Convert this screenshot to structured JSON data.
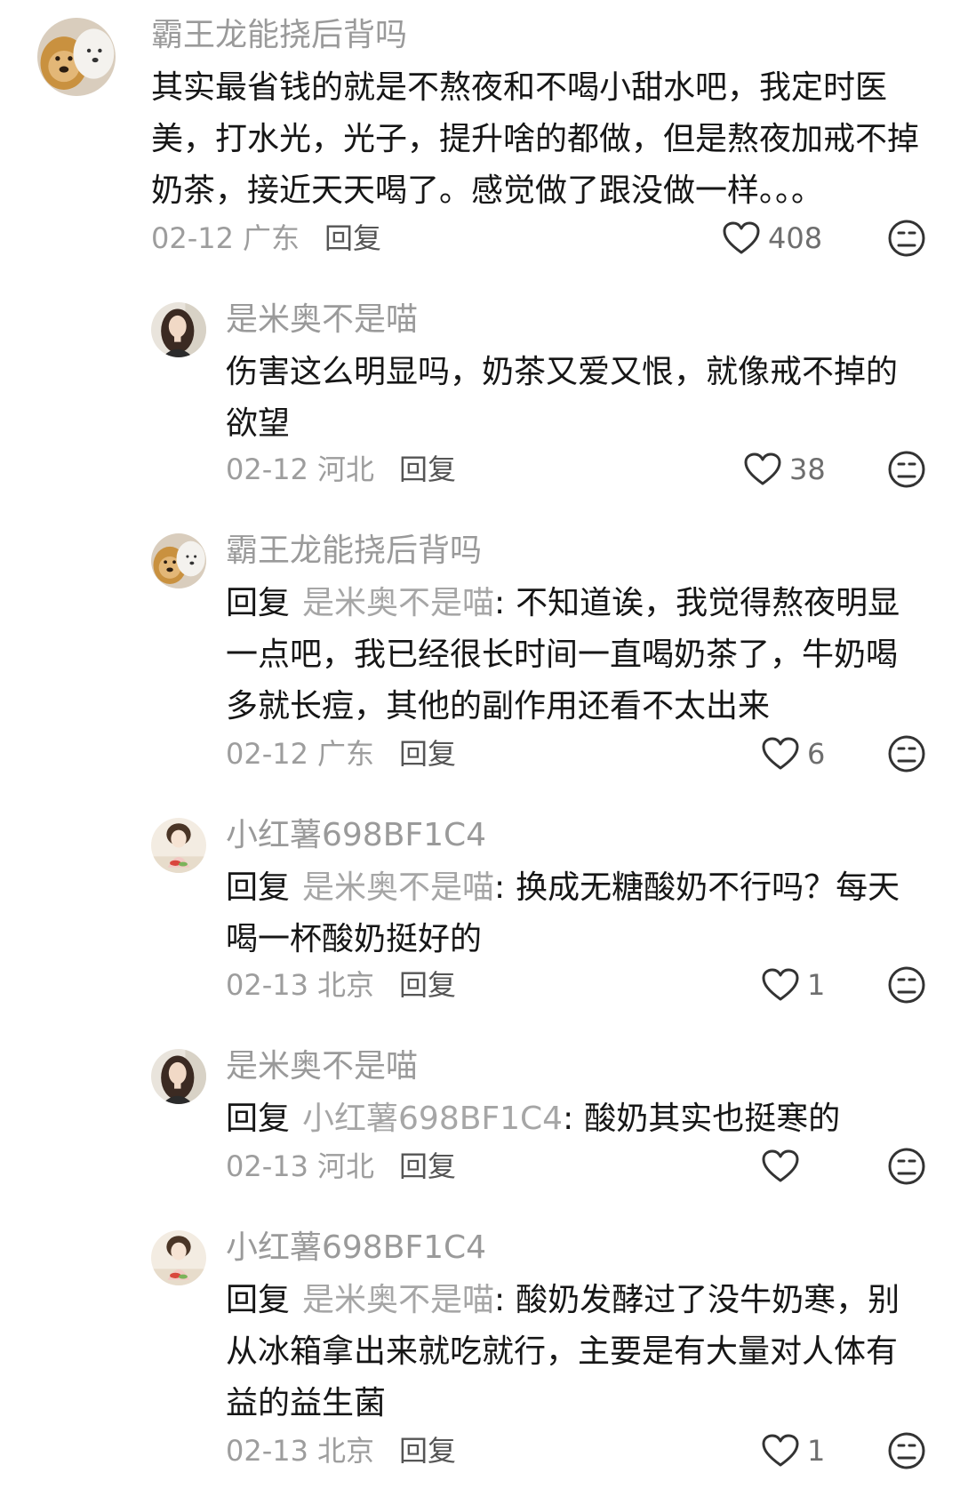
{
  "comments": [
    {
      "author": "霸王龙能挠后背吗",
      "avatar": "dog-avatar",
      "reply_label": "",
      "reply_to": "",
      "sep": "",
      "text": "其实最省钱的就是不熬夜和不喝小甜水吧，我定时医美，打水光，光子，提升啥的都做，但是熬夜加戒不掉奶茶，接近天天喝了。感觉做了跟没做一样。。。",
      "date": "02-12",
      "location": "广东",
      "reply_button": "回复",
      "likes": "408"
    },
    {
      "author": "是米奥不是喵",
      "avatar": "woman-avatar",
      "reply_label": "",
      "reply_to": "",
      "sep": "",
      "text": "伤害这么明显吗，奶茶又爱又恨，就像戒不掉的欲望",
      "date": "02-12",
      "location": "河北",
      "reply_button": "回复",
      "likes": "38"
    },
    {
      "author": "霸王龙能挠后背吗",
      "avatar": "dog-avatar",
      "reply_label": "回复",
      "reply_to": "是米奥不是喵",
      "sep": ":",
      "text": "不知道诶，我觉得熬夜明显一点吧，我已经很长时间一直喝奶茶了，牛奶喝多就长痘，其他的副作用还看不太出来",
      "date": "02-12",
      "location": "广东",
      "reply_button": "回复",
      "likes": "6"
    },
    {
      "author": "小红薯698BF1C4",
      "avatar": "cartoon-girl-avatar",
      "reply_label": "回复",
      "reply_to": "是米奥不是喵",
      "sep": ":",
      "text": "换成无糖酸奶不行吗？每天喝一杯酸奶挺好的",
      "date": "02-13",
      "location": "北京",
      "reply_button": "回复",
      "likes": "1"
    },
    {
      "author": "是米奥不是喵",
      "avatar": "woman-avatar",
      "reply_label": "回复",
      "reply_to": "小红薯698BF1C4",
      "sep": ":",
      "text": "酸奶其实也挺寒的",
      "date": "02-13",
      "location": "河北",
      "reply_button": "回复",
      "likes": ""
    },
    {
      "author": "小红薯698BF1C4",
      "avatar": "cartoon-girl-avatar",
      "reply_label": "回复",
      "reply_to": "是米奥不是喵",
      "sep": ":",
      "text": "酸奶发酵过了没牛奶寒，别从冰箱拿出来就吃就行，主要是有大量对人体有益的益生菌",
      "date": "02-13",
      "location": "北京",
      "reply_button": "回复",
      "likes": "1"
    }
  ],
  "icons": {
    "like": "heart-outline-icon",
    "dislike": "frown-face-icon"
  },
  "colors": {
    "author": "#9a9a9a",
    "text": "#161616",
    "meta": "#9d9d9d",
    "icon": "#333333"
  }
}
